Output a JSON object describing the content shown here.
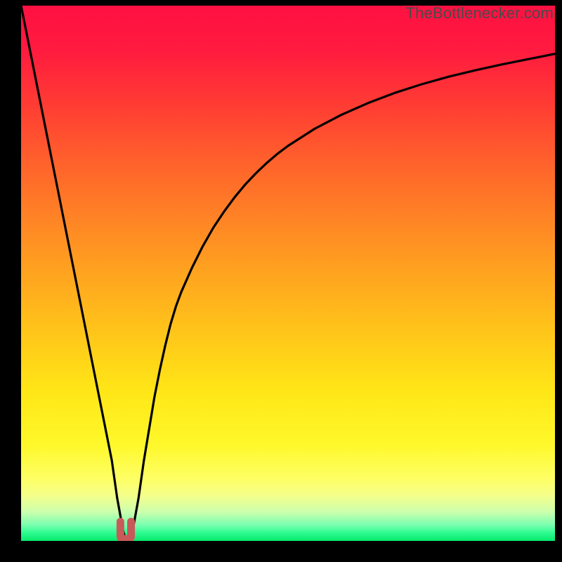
{
  "watermark": "TheBottleneсker.com",
  "chart_data": {
    "type": "line",
    "title": "",
    "xlabel": "",
    "ylabel": "",
    "xlim": [
      0,
      100
    ],
    "ylim": [
      0,
      100
    ],
    "note": "Qualitative bottleneck curve: V-shaped line reaching a minimum around x≈20 with an asymptotic rise toward the right. Background is a vertical red→yellow→green gradient. No axis ticks or numeric labels are rendered.",
    "x": [
      0,
      1,
      2,
      3,
      4,
      5,
      6,
      7,
      8,
      9,
      10,
      11,
      12,
      13,
      14,
      15,
      16,
      17,
      18,
      19,
      19.2,
      19.4,
      19.6,
      19.8,
      20,
      20.2,
      20.4,
      20.6,
      20.8,
      21,
      22,
      23,
      24,
      25,
      26,
      27,
      28,
      29,
      30,
      32,
      34,
      36,
      38,
      40,
      42,
      44,
      46,
      48,
      50,
      55,
      60,
      65,
      70,
      75,
      80,
      85,
      90,
      95,
      100
    ],
    "values": [
      100,
      95,
      90,
      85,
      80,
      75,
      70,
      65,
      60,
      55,
      50,
      45,
      40,
      35,
      30,
      25,
      20,
      15,
      8,
      2.5,
      1.6,
      1,
      0.7,
      0.6,
      0.5,
      0.6,
      0.7,
      1,
      1.6,
      2.5,
      8,
      15,
      21,
      27,
      32,
      36.5,
      40.5,
      43.8,
      46.5,
      51,
      55,
      58.5,
      61.5,
      64.2,
      66.6,
      68.7,
      70.6,
      72.3,
      73.8,
      77,
      79.6,
      81.8,
      83.7,
      85.3,
      86.7,
      87.9,
      89,
      90,
      91
    ],
    "marker": {
      "x_range": [
        18.6,
        20.6
      ],
      "y_base": 0.4,
      "height": 3.2,
      "color": "#c95a5a"
    },
    "gradient_stops": [
      {
        "offset": 0,
        "color": "#ff1142"
      },
      {
        "offset": 0.08,
        "color": "#ff1a3f"
      },
      {
        "offset": 0.18,
        "color": "#ff3a34"
      },
      {
        "offset": 0.3,
        "color": "#ff642b"
      },
      {
        "offset": 0.45,
        "color": "#ff9422"
      },
      {
        "offset": 0.6,
        "color": "#ffc21a"
      },
      {
        "offset": 0.72,
        "color": "#ffe617"
      },
      {
        "offset": 0.82,
        "color": "#fff82a"
      },
      {
        "offset": 0.885,
        "color": "#feff66"
      },
      {
        "offset": 0.915,
        "color": "#f4ff8a"
      },
      {
        "offset": 0.945,
        "color": "#ceffad"
      },
      {
        "offset": 0.97,
        "color": "#7bffb0"
      },
      {
        "offset": 0.985,
        "color": "#2dfc91"
      },
      {
        "offset": 1.0,
        "color": "#06e96b"
      }
    ]
  }
}
